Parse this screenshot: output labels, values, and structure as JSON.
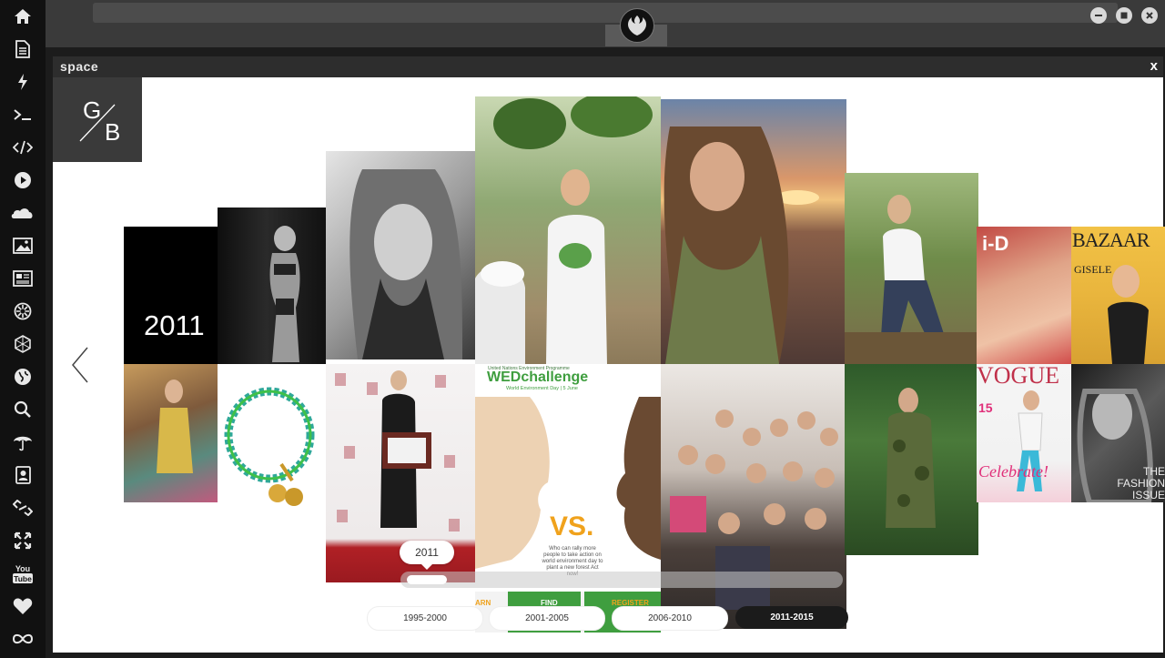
{
  "panel": {
    "title": "space",
    "close_label": "x"
  },
  "logo": {
    "top_letter": "G",
    "bottom_letter": "B"
  },
  "gallery": {
    "year_label": "2011"
  },
  "timeline": {
    "bubble_label": "2011",
    "ranges": [
      "1995-2000",
      "2001-2005",
      "2006-2010",
      "2011-2015"
    ],
    "active_range": "2011-2015"
  },
  "poster": {
    "org_line": "United Nations Environment Programme",
    "title": "WEDchallenge",
    "subtitle": "World Environment Day | 5 June",
    "vs": "VS.",
    "body": "Who can rally more people to take action on world environment day to plant a new forest Act now!",
    "footer_left": "ARN",
    "footer_find": "FIND",
    "footer_register": "REGISTER"
  },
  "magazines": {
    "id_logo": "i-D",
    "bazaar_logo": "BAZAAR",
    "bazaar_cover_name": "GISELE",
    "vogue_logo": "VOGUE",
    "vogue_cover_text": "Celebrate!",
    "vogue_issue": "15",
    "fashion_text": "THE FASHION ISSUE"
  },
  "sidebar_icons": [
    "home-icon",
    "document-icon",
    "lightning-icon",
    "terminal-icon",
    "code-icon",
    "play-icon",
    "cloud-icon",
    "image-icon",
    "news-icon",
    "settings-wheel-icon",
    "hexagon-icon",
    "globe-icon",
    "search-icon",
    "umbrella-icon",
    "contacts-icon",
    "link-icon",
    "expand-icon",
    "youtube-icon",
    "heart-icon",
    "infinity-icon"
  ],
  "colors": {
    "sidebar_bg": "#111111",
    "panel_header": "#2d2d2d",
    "logo_bg": "#3a3a3a",
    "poster_green": "#3f9e3f",
    "vs_orange": "#f0a21c"
  }
}
